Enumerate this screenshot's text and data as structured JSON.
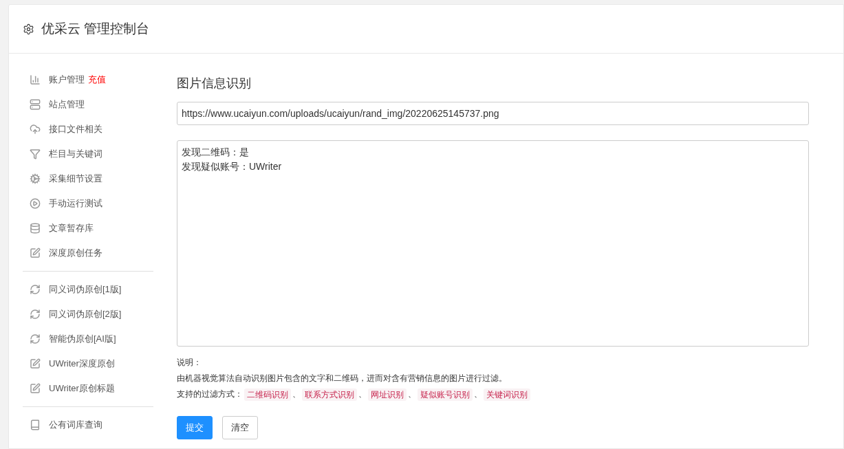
{
  "header": {
    "title": "优采云 管理控制台"
  },
  "sidebar": {
    "groups": [
      {
        "items": [
          {
            "kind": "chart",
            "label": "账户管理",
            "badge": "充值"
          },
          {
            "kind": "server",
            "label": "站点管理"
          },
          {
            "kind": "cloud",
            "label": "接口文件相关"
          },
          {
            "kind": "filter",
            "label": "栏目与关键词"
          },
          {
            "kind": "gears",
            "label": "采集细节设置"
          },
          {
            "kind": "play",
            "label": "手动运行测试"
          },
          {
            "kind": "database",
            "label": "文章暂存库"
          },
          {
            "kind": "edit",
            "label": "深度原创任务"
          }
        ]
      },
      {
        "items": [
          {
            "kind": "refresh",
            "label": "同义词伪原创[1版]"
          },
          {
            "kind": "refresh",
            "label": "同义词伪原创[2版]"
          },
          {
            "kind": "refresh",
            "label": "智能伪原创[AI版]"
          },
          {
            "kind": "edit",
            "label": "UWriter深度原创"
          },
          {
            "kind": "edit",
            "label": "UWriter原创标题"
          }
        ]
      },
      {
        "items": [
          {
            "kind": "book",
            "label": "公有词库查询"
          }
        ]
      }
    ]
  },
  "main": {
    "title": "图片信息识别",
    "url_field": {
      "value": "https://www.ucaiyun.com/uploads/ucaiyun/rand_img/20220625145737.png"
    },
    "result_lines": [
      "发现二维码：是",
      "发现疑似账号：UWriter"
    ],
    "note_label": "说明：",
    "note_text": "由机器视觉算法自动识别图片包含的文字和二维码，进而对含有营销信息的图片进行过滤。",
    "filters_label": "支持的过滤方式：",
    "filters": [
      "二维码识别",
      "联系方式识别",
      "网址识别",
      "疑似账号识别",
      "关键词识别"
    ],
    "separator": "、",
    "buttons": [
      {
        "kind": "primary",
        "label": "提交"
      },
      {
        "kind": "default",
        "label": "清空"
      }
    ]
  }
}
